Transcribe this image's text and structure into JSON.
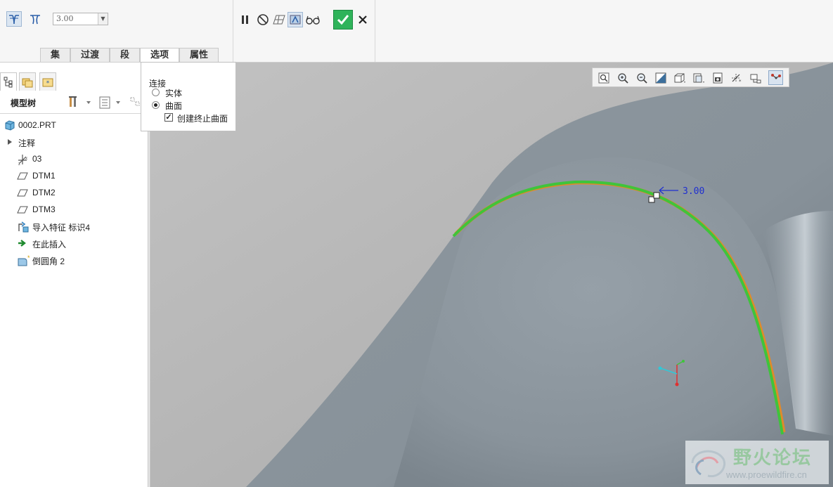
{
  "ribbon": {
    "value": "3.00",
    "tabs": [
      "集",
      "过渡",
      "段",
      "选项",
      "属性"
    ],
    "active_tab": "选项",
    "icons": [
      "round-set-icon",
      "round-set-alt-icon",
      "pause-icon",
      "no-preview-icon",
      "mesh-preview-icon",
      "verify-preview-icon",
      "glasses-preview-icon",
      "ok-check-icon",
      "cancel-x-icon"
    ]
  },
  "options": {
    "heading": "连接",
    "radio_solid": "实体",
    "radio_surface": "曲面",
    "selected": "曲面",
    "checkbox_label": "创建终止曲面",
    "checkbox_checked": true
  },
  "left_panel": {
    "tabs": [
      "model-tree-tab-icon",
      "folder-browser-tab-icon",
      "favorites-tab-icon"
    ],
    "header_title": "模型树",
    "tree": [
      {
        "label": "0002.PRT",
        "icon": "part-icon"
      },
      {
        "label": "注释",
        "icon": "expand-arrow-icon"
      },
      {
        "label": "03",
        "icon": "csys-icon"
      },
      {
        "label": "DTM1",
        "icon": "datum-plane-icon"
      },
      {
        "label": "DTM2",
        "icon": "datum-plane-icon"
      },
      {
        "label": "DTM3",
        "icon": "datum-plane-icon"
      },
      {
        "label": "导入特征 标识4",
        "icon": "import-feature-icon"
      },
      {
        "label": "在此插入",
        "icon": "insert-here-arrow-icon"
      },
      {
        "label": "倒圆角 2",
        "icon": "round-feature-icon"
      }
    ]
  },
  "viewport": {
    "dimension_label": "3.00",
    "view_toolbar_icons": [
      "refit-icon",
      "zoom-in-icon",
      "zoom-out-icon",
      "repaint-icon",
      "display-style-icon",
      "saved-views-icon",
      "view-manager-icon",
      "datum-display-icon",
      "spin-center-icon",
      "annotation-display-icon"
    ],
    "accent_green": "#3fc43b",
    "accent_orange": "#e08a2a",
    "dimension_blue": "#1f2fd0"
  },
  "watermark": {
    "title": "野火论坛",
    "url": "www.proewildfire.cn"
  }
}
